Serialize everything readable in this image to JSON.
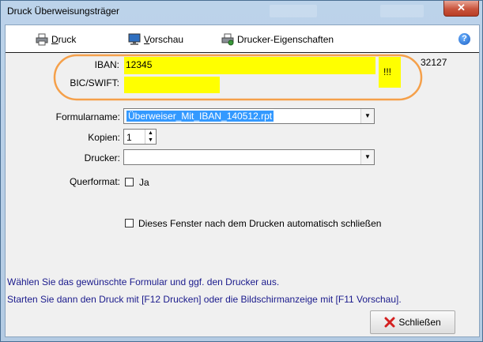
{
  "window": {
    "title": "Druck Überweisungsträger",
    "close_glyph": "✕"
  },
  "toolbar": {
    "print_mnemonic": "D",
    "print_rest": "ruck",
    "preview_mnemonic": "V",
    "preview_rest": "orschau",
    "props_label": "Drucker-Eigenschaften",
    "help_glyph": "?"
  },
  "bank": {
    "iban_label": "IBAN:",
    "iban_value": "12345",
    "bic_label": "BIC/SWIFT:",
    "bic_value": "",
    "warning": "!!!",
    "number": "32127",
    "highlight_color": "#ffff00",
    "annotation_color": "#f5a04a"
  },
  "form": {
    "formular_label": "Formularname:",
    "formular_value": "Überweiser_Mit_IBAN_140512.rpt",
    "kopien_label": "Kopien:",
    "kopien_value": "1",
    "drucker_label": "Drucker:",
    "drucker_value": "",
    "querformat_label": "Querformat:",
    "querformat_ja": "Ja",
    "autoclose_label": "Dieses Fenster nach dem Drucken automatisch schließen"
  },
  "info": {
    "line1": "Wählen Sie das gewünschte Formular und ggf. den Drucker aus.",
    "line2": "Starten Sie dann den Druck mit [F12 Drucken] oder die Bildschirmanzeige mit [F11 Vorschau]."
  },
  "footer": {
    "close_label": "Schließen",
    "close_icon": "red-x-icon"
  }
}
